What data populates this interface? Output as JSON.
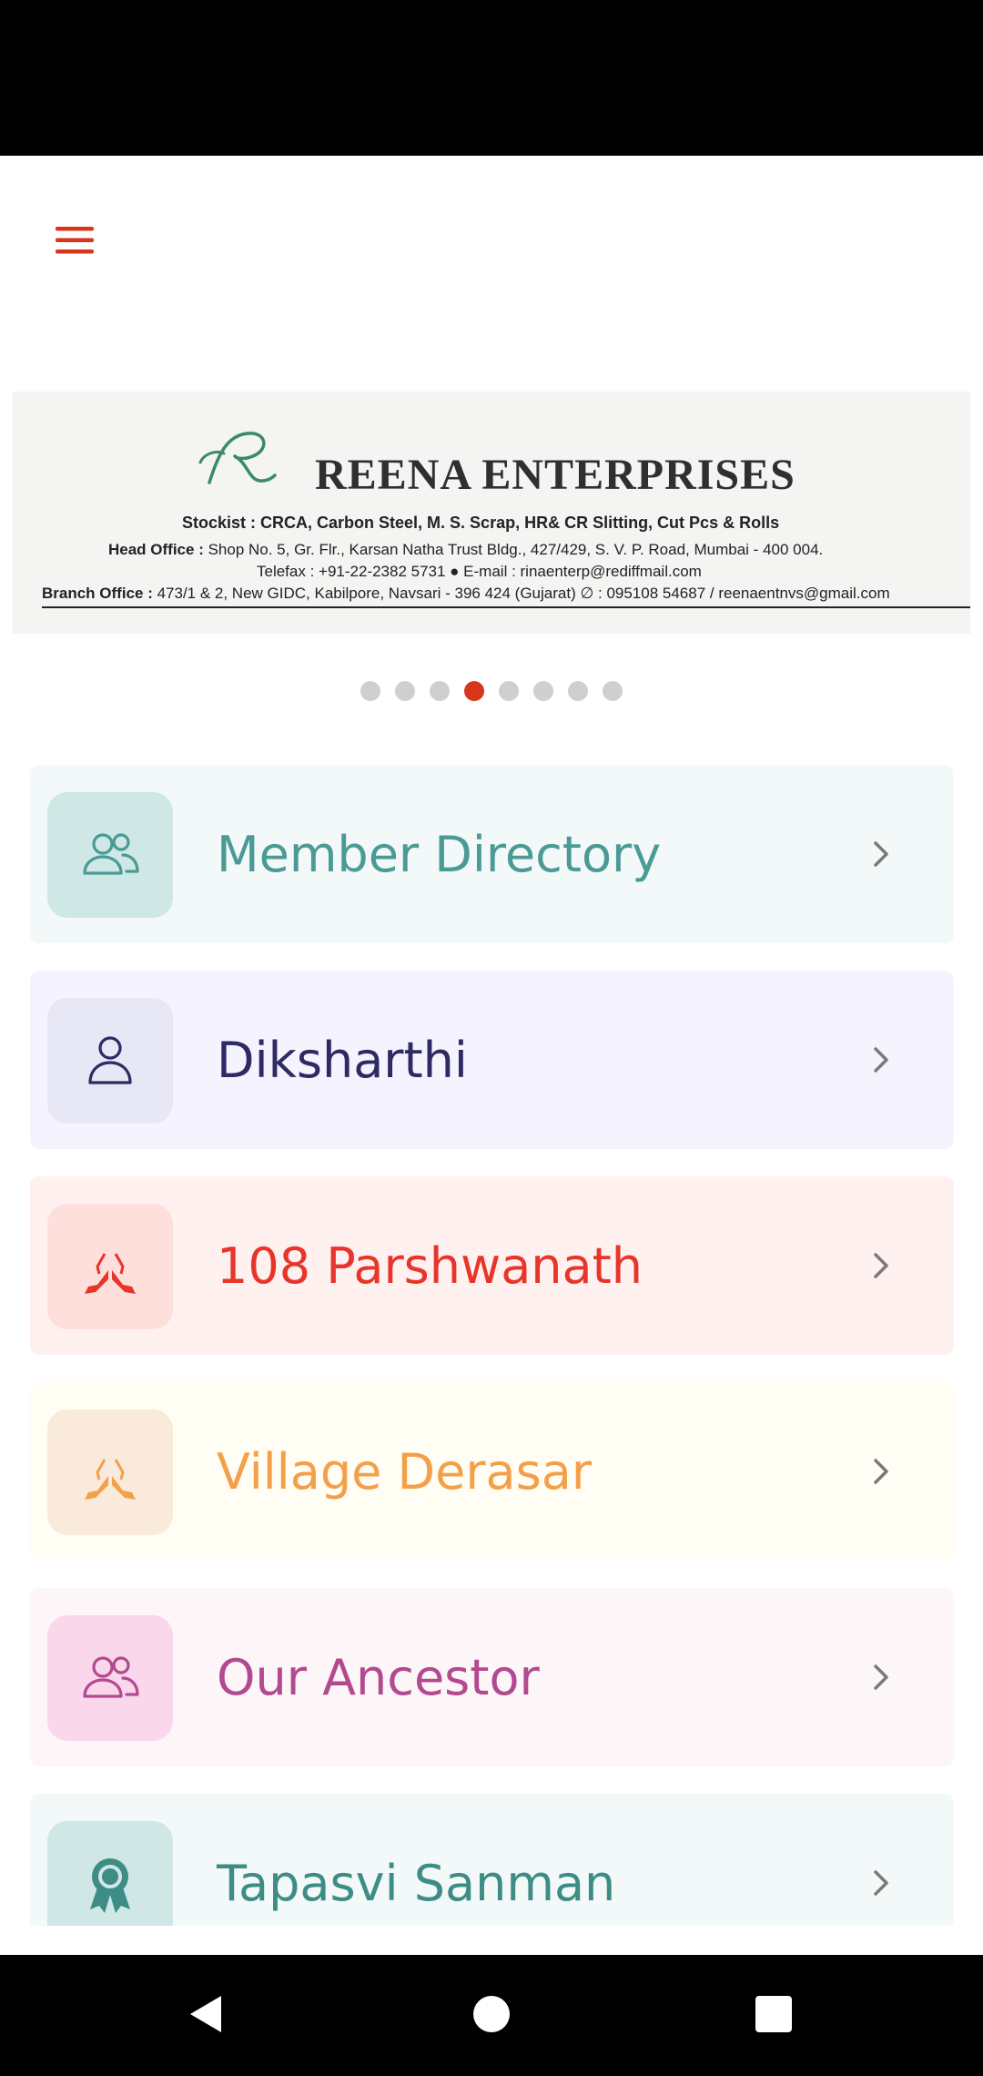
{
  "app_bar": {
    "menu_icon": "hamburger-menu-icon"
  },
  "banner": {
    "company": "REENA ENTERPRISES",
    "stockist": "Stockist : CRCA, Carbon Steel, M. S. Scrap, HR& CR Slitting, Cut Pcs & Rolls",
    "head_office_label": "Head Office :",
    "head_office": " Shop No. 5, Gr. Flr., Karsan Natha Trust Bldg., 427/429, S. V. P. Road, Mumbai - 400 004.",
    "telefax": "Telefax : +91-22-2382 5731 ● E-mail : rinaenterp@rediffmail.com",
    "branch_office_label": "Branch Office :",
    "branch_office": " 473/1 & 2, New GIDC, Kabilpore, Navsari - 396 424 (Gujarat) ∅ : 095108 54687 / reenaentnvs@gmail.com"
  },
  "carousel": {
    "count": 8,
    "active_index": 3,
    "active_color": "#d6361a",
    "inactive_color": "#cfcfcf"
  },
  "menu_items": [
    {
      "label": "Member Directory",
      "icon": "people-icon",
      "text_color": "#4a9a96",
      "bg": "#f3f8f8",
      "icon_bg": "#cfe7e5"
    },
    {
      "label": "Diksharthi",
      "icon": "person-icon",
      "text_color": "#2e2a63",
      "bg": "#f5f4fe",
      "icon_bg": "#e8e7f5"
    },
    {
      "label": "108 Parshwanath",
      "icon": "praying-hands-icon",
      "text_color": "#e8352a",
      "bg": "#fff1f0",
      "icon_bg": "#ffdfdc"
    },
    {
      "label": "Village Derasar",
      "icon": "praying-hands-icon",
      "text_color": "#f4a04a",
      "bg": "#fffdf4",
      "icon_bg": "#faeadb"
    },
    {
      "label": "Our Ancestor",
      "icon": "people-icon",
      "text_color": "#b3498f",
      "bg": "#fdf6f8",
      "icon_bg": "#fbd7ec"
    },
    {
      "label": "Tapasvi Sanman",
      "icon": "award-ribbon-icon",
      "text_color": "#3d8c86",
      "bg": "#f3f8f8",
      "icon_bg": "#cfe7e5"
    }
  ],
  "nav_bar": {
    "back": "back-icon",
    "home": "home-icon",
    "recents": "recents-icon"
  }
}
